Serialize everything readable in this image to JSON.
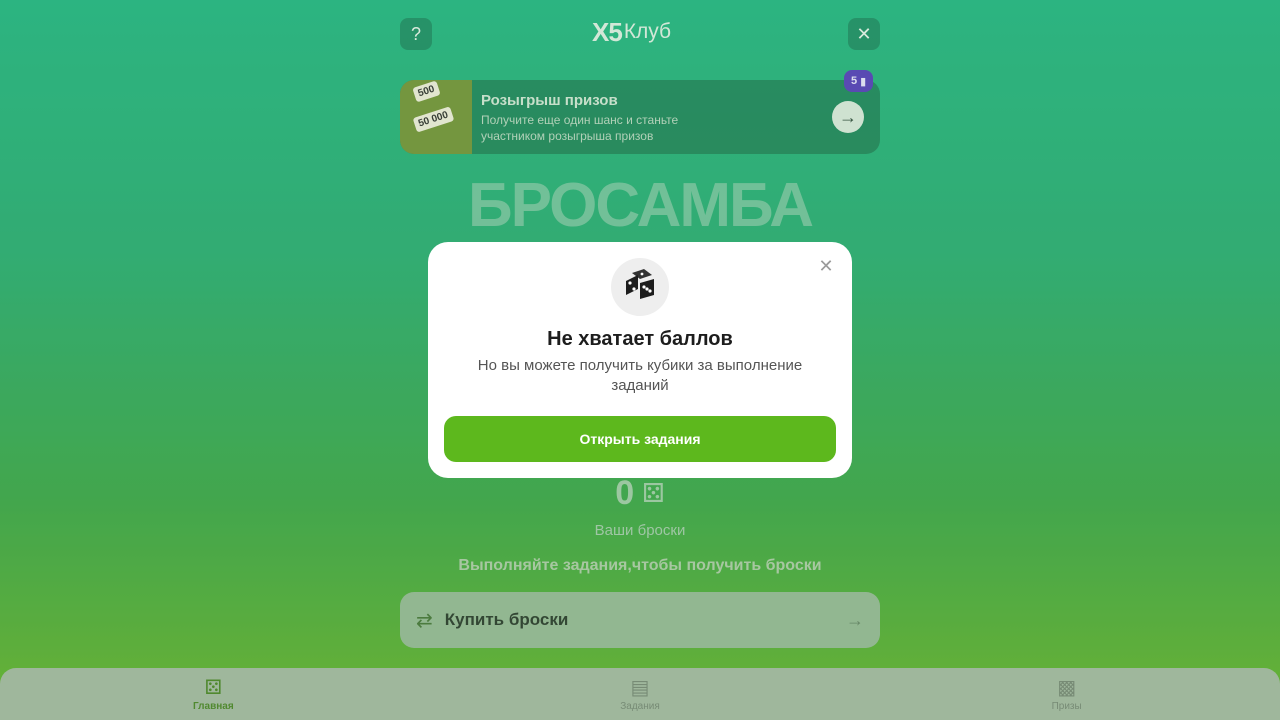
{
  "header": {
    "help_label": "?",
    "close_label": "✕",
    "logo_mark": "X5",
    "logo_text": "Клуб"
  },
  "banner": {
    "title": "Розыгрыш призов",
    "subtitle": "Получите еще один шанс и станьте участником розыгрыша призов",
    "badge_count": "5",
    "ticket_1": "500",
    "ticket_2": "50 000"
  },
  "game": {
    "title": "БРОСАМБА",
    "throws_count": "0",
    "throws_label": "Ваши броски",
    "hint": "Выполняйте задания,чтобы получить броски",
    "buy_label": "Купить броски"
  },
  "nav": {
    "items": [
      {
        "label": "Главная",
        "icon": "dice-icon",
        "active": true
      },
      {
        "label": "Задания",
        "icon": "clipboard-icon",
        "active": false
      },
      {
        "label": "Призы",
        "icon": "gift-icon",
        "active": false
      }
    ]
  },
  "modal": {
    "title": "Не хватает баллов",
    "text": "Но вы можете получить кубики за выполнение заданий",
    "button_label": "Открыть задания",
    "close_label": "✕"
  },
  "colors": {
    "accent": "#5db81d",
    "badge": "#4a2fb8"
  }
}
